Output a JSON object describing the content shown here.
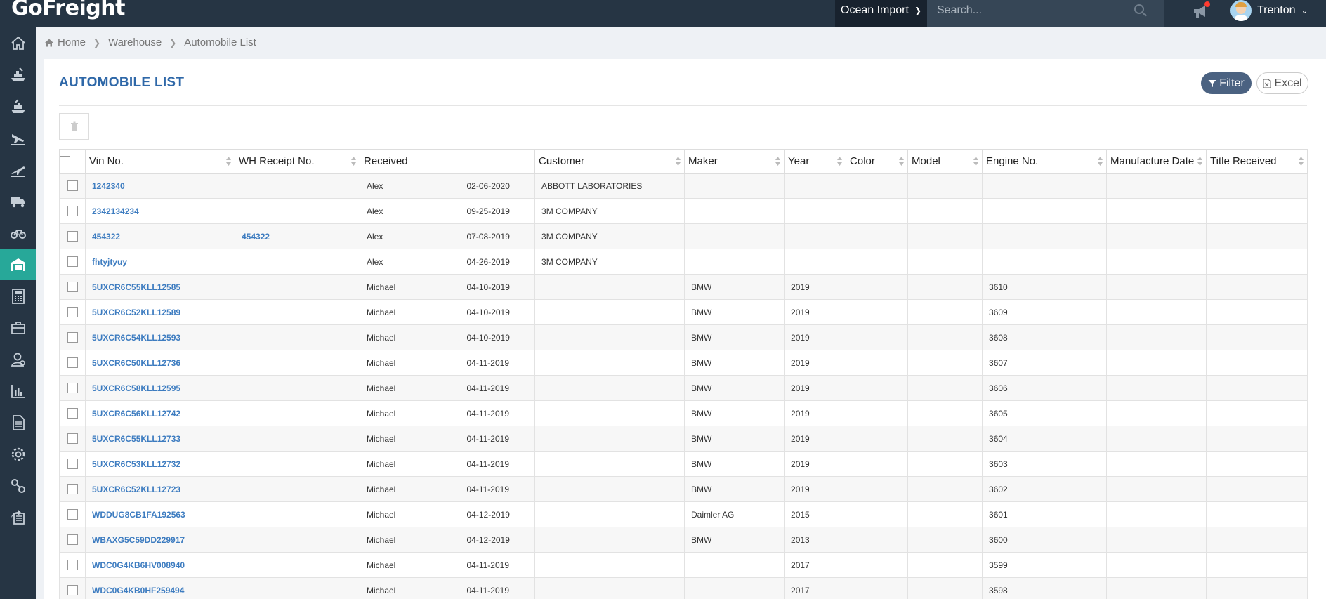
{
  "app": {
    "logo": "GoFreight",
    "mode": "Ocean Import",
    "search_placeholder": "Search...",
    "user": "Trenton"
  },
  "breadcrumb": [
    "Home",
    "Warehouse",
    "Automobile List"
  ],
  "page": {
    "title": "AUTOMOBILE LIST",
    "filter_label": "Filter",
    "excel_label": "Excel"
  },
  "sidebar": {
    "items": [
      "home-icon",
      "ship-icon",
      "ship-export-icon",
      "plane-landing-icon",
      "plane-takeoff-icon",
      "truck-icon",
      "bicycle-icon",
      "warehouse-icon",
      "calculator-icon",
      "briefcase-icon",
      "contacts-icon",
      "bar-chart-icon",
      "document-icon",
      "gear-icon",
      "link-icon",
      "share-icon"
    ],
    "active_index": 7
  },
  "table": {
    "columns": [
      "Vin No.",
      "WH Receipt No.",
      "Received",
      "Customer",
      "Maker",
      "Year",
      "Color",
      "Model",
      "Engine No.",
      "Manufacture Date",
      "Title Received"
    ],
    "rows": [
      {
        "vin": "1242340",
        "wh": "",
        "recv_by": "Alex",
        "recv_date": "02-06-2020",
        "customer": "ABBOTT LABORATORIES",
        "maker": "",
        "year": "",
        "color": "",
        "model": "",
        "engine": "",
        "mfg": "",
        "title": ""
      },
      {
        "vin": "2342134234",
        "wh": "",
        "recv_by": "Alex",
        "recv_date": "09-25-2019",
        "customer": "3M COMPANY",
        "maker": "",
        "year": "",
        "color": "",
        "model": "",
        "engine": "",
        "mfg": "",
        "title": ""
      },
      {
        "vin": "454322",
        "wh": "454322",
        "recv_by": "Alex",
        "recv_date": "07-08-2019",
        "customer": "3M COMPANY",
        "maker": "",
        "year": "",
        "color": "",
        "model": "",
        "engine": "",
        "mfg": "",
        "title": ""
      },
      {
        "vin": "fhtyjtyuy",
        "wh": "",
        "recv_by": "Alex",
        "recv_date": "04-26-2019",
        "customer": "3M COMPANY",
        "maker": "",
        "year": "",
        "color": "",
        "model": "",
        "engine": "",
        "mfg": "",
        "title": ""
      },
      {
        "vin": "5UXCR6C55KLL12585",
        "wh": "",
        "recv_by": "Michael",
        "recv_date": "04-10-2019",
        "customer": "",
        "maker": "BMW",
        "year": "2019",
        "color": "",
        "model": "",
        "engine": "3610",
        "mfg": "",
        "title": ""
      },
      {
        "vin": "5UXCR6C52KLL12589",
        "wh": "",
        "recv_by": "Michael",
        "recv_date": "04-10-2019",
        "customer": "",
        "maker": "BMW",
        "year": "2019",
        "color": "",
        "model": "",
        "engine": "3609",
        "mfg": "",
        "title": ""
      },
      {
        "vin": "5UXCR6C54KLL12593",
        "wh": "",
        "recv_by": "Michael",
        "recv_date": "04-10-2019",
        "customer": "",
        "maker": "BMW",
        "year": "2019",
        "color": "",
        "model": "",
        "engine": "3608",
        "mfg": "",
        "title": ""
      },
      {
        "vin": "5UXCR6C50KLL12736",
        "wh": "",
        "recv_by": "Michael",
        "recv_date": "04-11-2019",
        "customer": "",
        "maker": "BMW",
        "year": "2019",
        "color": "",
        "model": "",
        "engine": "3607",
        "mfg": "",
        "title": ""
      },
      {
        "vin": "5UXCR6C58KLL12595",
        "wh": "",
        "recv_by": "Michael",
        "recv_date": "04-11-2019",
        "customer": "",
        "maker": "BMW",
        "year": "2019",
        "color": "",
        "model": "",
        "engine": "3606",
        "mfg": "",
        "title": ""
      },
      {
        "vin": "5UXCR6C56KLL12742",
        "wh": "",
        "recv_by": "Michael",
        "recv_date": "04-11-2019",
        "customer": "",
        "maker": "BMW",
        "year": "2019",
        "color": "",
        "model": "",
        "engine": "3605",
        "mfg": "",
        "title": ""
      },
      {
        "vin": "5UXCR6C55KLL12733",
        "wh": "",
        "recv_by": "Michael",
        "recv_date": "04-11-2019",
        "customer": "",
        "maker": "BMW",
        "year": "2019",
        "color": "",
        "model": "",
        "engine": "3604",
        "mfg": "",
        "title": ""
      },
      {
        "vin": "5UXCR6C53KLL12732",
        "wh": "",
        "recv_by": "Michael",
        "recv_date": "04-11-2019",
        "customer": "",
        "maker": "BMW",
        "year": "2019",
        "color": "",
        "model": "",
        "engine": "3603",
        "mfg": "",
        "title": ""
      },
      {
        "vin": "5UXCR6C52KLL12723",
        "wh": "",
        "recv_by": "Michael",
        "recv_date": "04-11-2019",
        "customer": "",
        "maker": "BMW",
        "year": "2019",
        "color": "",
        "model": "",
        "engine": "3602",
        "mfg": "",
        "title": ""
      },
      {
        "vin": "WDDUG8CB1FA192563",
        "wh": "",
        "recv_by": "Michael",
        "recv_date": "04-12-2019",
        "customer": "",
        "maker": "Daimler AG",
        "year": "2015",
        "color": "",
        "model": "",
        "engine": "3601",
        "mfg": "",
        "title": ""
      },
      {
        "vin": "WBAXG5C59DD229917",
        "wh": "",
        "recv_by": "Michael",
        "recv_date": "04-12-2019",
        "customer": "",
        "maker": "BMW",
        "year": "2013",
        "color": "",
        "model": "",
        "engine": "3600",
        "mfg": "",
        "title": ""
      },
      {
        "vin": "WDC0G4KB6HV008940",
        "wh": "",
        "recv_by": "Michael",
        "recv_date": "04-11-2019",
        "customer": "",
        "maker": "",
        "year": "2017",
        "color": "",
        "model": "",
        "engine": "3599",
        "mfg": "",
        "title": ""
      },
      {
        "vin": "WDC0G4KB0HF259494",
        "wh": "",
        "recv_by": "Michael",
        "recv_date": "04-11-2019",
        "customer": "",
        "maker": "",
        "year": "2017",
        "color": "",
        "model": "",
        "engine": "3598",
        "mfg": "",
        "title": ""
      }
    ]
  },
  "colors": {
    "topbar": "#263544",
    "sidebar_active": "#27a899",
    "title": "#2f68a8",
    "link": "#3d7cc0",
    "filter_button": "#4b6281",
    "notification_dot": "#ff3b30"
  }
}
